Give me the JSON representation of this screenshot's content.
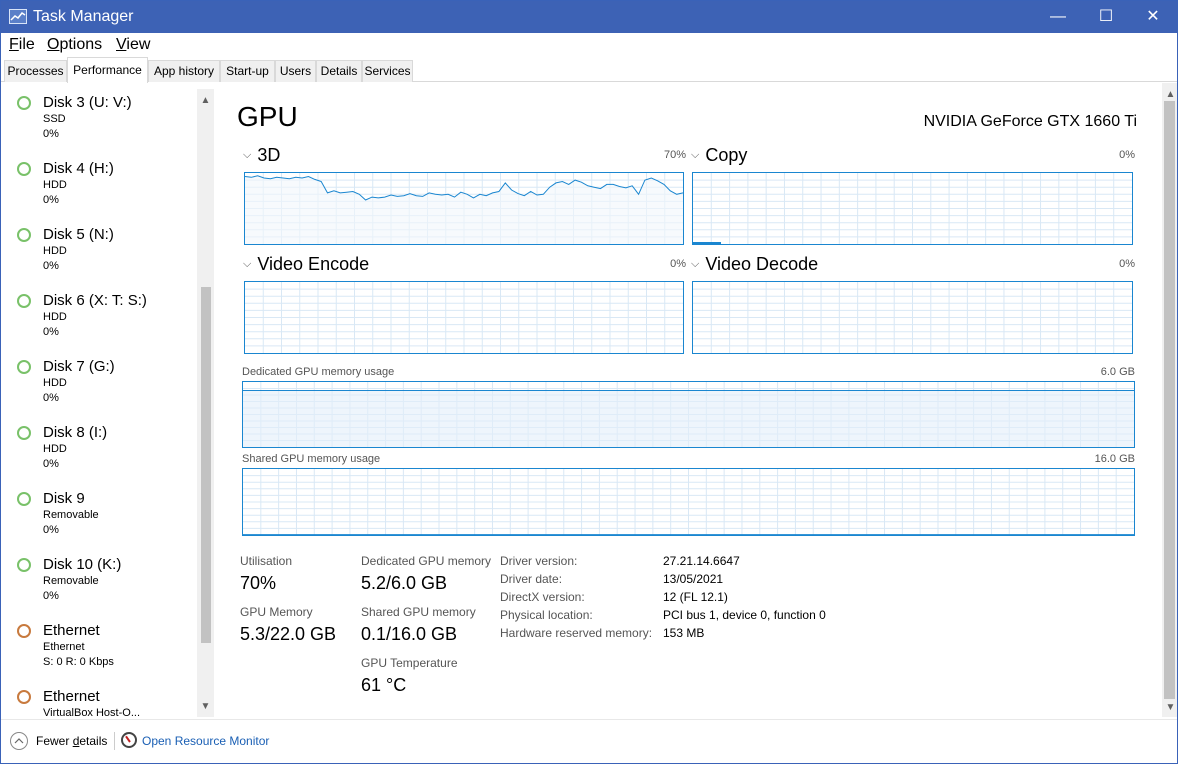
{
  "window": {
    "title": "Task Manager",
    "minimize": "—",
    "maximize": "☐",
    "close": "✕"
  },
  "menu": [
    {
      "label": "File",
      "accel": "F",
      "rest": "ile"
    },
    {
      "label": "Options",
      "accel": "O",
      "rest": "ptions"
    },
    {
      "label": "View",
      "accel": "V",
      "rest": "iew"
    }
  ],
  "tabs": [
    "Processes",
    "Performance",
    "App history",
    "Start-up",
    "Users",
    "Details",
    "Services"
  ],
  "sidebar": {
    "items": [
      {
        "name": "Disk 3 (U: V:)",
        "type": "SSD",
        "value": "0%",
        "status": "green"
      },
      {
        "name": "Disk 4 (H:)",
        "type": "HDD",
        "value": "0%",
        "status": "green"
      },
      {
        "name": "Disk 5 (N:)",
        "type": "HDD",
        "value": "0%",
        "status": "green"
      },
      {
        "name": "Disk 6 (X: T: S:)",
        "type": "HDD",
        "value": "0%",
        "status": "green"
      },
      {
        "name": "Disk 7 (G:)",
        "type": "HDD",
        "value": "0%",
        "status": "green"
      },
      {
        "name": "Disk 8 (I:)",
        "type": "HDD",
        "value": "0%",
        "status": "green"
      },
      {
        "name": "Disk 9",
        "type": "Removable",
        "value": "0%",
        "status": "green"
      },
      {
        "name": "Disk 10 (K:)",
        "type": "Removable",
        "value": "0%",
        "status": "green"
      },
      {
        "name": "Ethernet",
        "type": "Ethernet",
        "value": "S: 0 R: 0 Kbps",
        "status": "orange"
      },
      {
        "name": "Ethernet",
        "type": "VirtualBox Host-O...",
        "value": "",
        "status": "orange"
      }
    ]
  },
  "gpu": {
    "title": "GPU",
    "model": "NVIDIA GeForce GTX 1660 Ti",
    "graphs": {
      "3d": {
        "label": "3D",
        "pct": "70%"
      },
      "copy": {
        "label": "Copy",
        "pct": "0%"
      },
      "video_encode": {
        "label": "Video Encode",
        "pct": "0%"
      },
      "video_decode": {
        "label": "Video Decode",
        "pct": "0%"
      }
    },
    "dedicated_mem": {
      "label": "Dedicated GPU memory usage",
      "max": "6.0 GB",
      "level": 0.87
    },
    "shared_mem": {
      "label": "Shared GPU memory usage",
      "max": "16.0 GB",
      "level": 0.006
    },
    "line_3d": [
      0.95,
      0.94,
      0.96,
      0.93,
      0.92,
      0.94,
      0.93,
      0.92,
      0.94,
      0.93,
      0.95,
      0.91,
      0.88,
      0.72,
      0.75,
      0.72,
      0.73,
      0.74,
      0.7,
      0.62,
      0.66,
      0.65,
      0.66,
      0.69,
      0.67,
      0.68,
      0.71,
      0.68,
      0.67,
      0.72,
      0.7,
      0.69,
      0.7,
      0.66,
      0.73,
      0.7,
      0.65,
      0.7,
      0.68,
      0.72,
      0.74,
      0.86,
      0.76,
      0.71,
      0.68,
      0.74,
      0.69,
      0.7,
      0.8,
      0.86,
      0.88,
      0.84,
      0.9,
      0.87,
      0.82,
      0.8,
      0.78,
      0.84,
      0.84,
      0.81,
      0.79,
      0.82,
      0.7,
      0.9,
      0.93,
      0.89,
      0.84,
      0.75,
      0.7,
      0.72
    ]
  },
  "stats": {
    "utilisation": {
      "label": "Utilisation",
      "value": "70%"
    },
    "gpu_memory": {
      "label": "GPU Memory",
      "value": "5.3/22.0 GB"
    },
    "dedicated": {
      "label": "Dedicated GPU memory",
      "value": "5.2/6.0 GB"
    },
    "shared": {
      "label": "Shared GPU memory",
      "value": "0.1/16.0 GB"
    },
    "temperature": {
      "label": "GPU Temperature",
      "value": "61 °C"
    }
  },
  "info": [
    {
      "label": "Driver version:",
      "value": "27.21.14.6647"
    },
    {
      "label": "Driver date:",
      "value": "13/05/2021"
    },
    {
      "label": "DirectX version:",
      "value": "12 (FL 12.1)"
    },
    {
      "label": "Physical location:",
      "value": "PCI bus 1, device 0, function 0"
    },
    {
      "label": "Hardware reserved memory:",
      "value": "153 MB"
    }
  ],
  "footer": {
    "fewer_details": "Fewer details",
    "fewer_accel": "d",
    "open_monitor": "Open Resource Monitor"
  },
  "colors": {
    "titlebar": "#3d62b5",
    "graph_border": "#1a86d0",
    "graph_line": "#1a86d0",
    "graph_fill": "#f1f6fc",
    "grid": "#d9e8f5"
  }
}
